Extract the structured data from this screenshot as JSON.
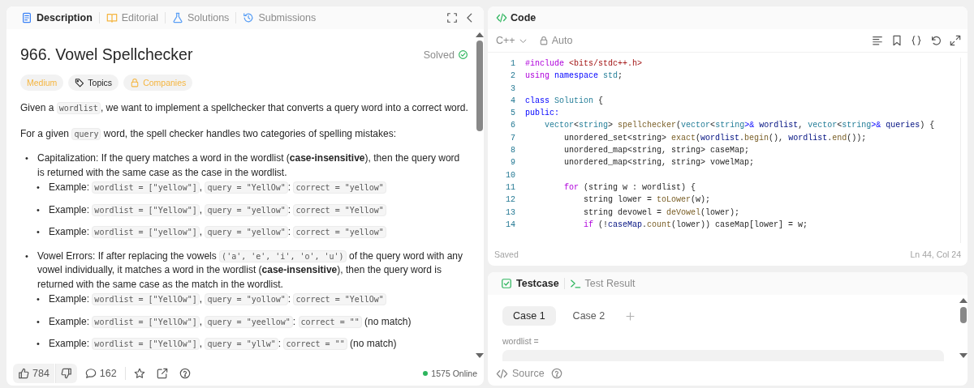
{
  "description": {
    "tabs": [
      {
        "label": "Description",
        "selected": true
      },
      {
        "label": "Editorial",
        "selected": false
      },
      {
        "label": "Solutions",
        "selected": false
      },
      {
        "label": "Submissions",
        "selected": false
      }
    ],
    "title": "966. Vowel Spellchecker",
    "status": "Solved",
    "tags": [
      {
        "label": "Medium",
        "kind": "difficulty"
      },
      {
        "label": "Topics",
        "kind": "topics"
      },
      {
        "label": "Companies",
        "kind": "companies"
      }
    ],
    "content": [
      {
        "kind": "paragraph",
        "parts": [
          {
            "kind": "text",
            "text": "Given a "
          },
          {
            "kind": "code",
            "text": "wordlist"
          },
          {
            "kind": "text",
            "text": ", we want to implement a spellchecker that converts a query word into a correct word."
          }
        ]
      },
      {
        "kind": "paragraph",
        "parts": [
          {
            "kind": "text",
            "text": "For a given "
          },
          {
            "kind": "code",
            "text": "query"
          },
          {
            "kind": "text",
            "text": " word, the spell checker handles two categories of spelling mistakes:"
          }
        ]
      },
      {
        "kind": "bullet",
        "marker": "•",
        "parts": [
          {
            "kind": "text",
            "text": "Capitalization: If the query matches a word in the wordlist ("
          },
          {
            "kind": "bold",
            "text": "case-insensitive"
          },
          {
            "kind": "text",
            "text": "), then the query word is returned with the same case as the case in the wordlist."
          }
        ],
        "children": [
          {
            "marker": "•",
            "parts": [
              {
                "kind": "text",
                "text": "Example: "
              },
              {
                "kind": "code",
                "text": "wordlist = [\"yellow\"]"
              },
              {
                "kind": "text",
                "text": ", "
              },
              {
                "kind": "code",
                "text": "query = \"YellOw\""
              },
              {
                "kind": "text",
                "text": ": "
              },
              {
                "kind": "code",
                "text": "correct = \"yellow\""
              }
            ]
          },
          {
            "marker": "•",
            "parts": [
              {
                "kind": "text",
                "text": "Example: "
              },
              {
                "kind": "code",
                "text": "wordlist = [\"Yellow\"]"
              },
              {
                "kind": "text",
                "text": ", "
              },
              {
                "kind": "code",
                "text": "query = \"yellow\""
              },
              {
                "kind": "text",
                "text": ": "
              },
              {
                "kind": "code",
                "text": "correct = \"Yellow\""
              }
            ]
          },
          {
            "marker": "•",
            "parts": [
              {
                "kind": "text",
                "text": "Example: "
              },
              {
                "kind": "code",
                "text": "wordlist = [\"yellow\"]"
              },
              {
                "kind": "text",
                "text": ", "
              },
              {
                "kind": "code",
                "text": "query = \"yellow\""
              },
              {
                "kind": "text",
                "text": ": "
              },
              {
                "kind": "code",
                "text": "correct = \"yellow\""
              }
            ]
          }
        ]
      },
      {
        "kind": "bullet",
        "marker": "•",
        "parts": [
          {
            "kind": "text",
            "text": "Vowel Errors: If after replacing the vowels "
          },
          {
            "kind": "code",
            "text": "('a', 'e', 'i', 'o', 'u')"
          },
          {
            "kind": "text",
            "text": " of the query word with any vowel individually, it matches a word in the wordlist ("
          },
          {
            "kind": "bold",
            "text": "case-insensitive"
          },
          {
            "kind": "text",
            "text": "), then the query word is returned with the same case as the match in the wordlist."
          }
        ],
        "children": [
          {
            "marker": "•",
            "parts": [
              {
                "kind": "text",
                "text": "Example: "
              },
              {
                "kind": "code",
                "text": "wordlist = [\"YellOw\"]"
              },
              {
                "kind": "text",
                "text": ", "
              },
              {
                "kind": "code",
                "text": "query = \"yollow\""
              },
              {
                "kind": "text",
                "text": ": "
              },
              {
                "kind": "code",
                "text": "correct = \"YellOw\""
              }
            ]
          },
          {
            "marker": "•",
            "parts": [
              {
                "kind": "text",
                "text": "Example: "
              },
              {
                "kind": "code",
                "text": "wordlist = [\"YellOw\"]"
              },
              {
                "kind": "text",
                "text": ", "
              },
              {
                "kind": "code",
                "text": "query = \"yeellow\""
              },
              {
                "kind": "text",
                "text": ": "
              },
              {
                "kind": "code",
                "text": "correct = \"\""
              },
              {
                "kind": "text",
                "text": " (no match)"
              }
            ]
          },
          {
            "marker": "•",
            "parts": [
              {
                "kind": "text",
                "text": "Example: "
              },
              {
                "kind": "code",
                "text": "wordlist = [\"YellOw\"]"
              },
              {
                "kind": "text",
                "text": ", "
              },
              {
                "kind": "code",
                "text": "query = \"yllw\""
              },
              {
                "kind": "text",
                "text": ": "
              },
              {
                "kind": "code",
                "text": "correct = \"\""
              },
              {
                "kind": "text",
                "text": " (no match)"
              }
            ]
          }
        ]
      }
    ],
    "likes": "784",
    "comments": "162",
    "online": "1575 Online"
  },
  "code": {
    "title": "Code",
    "language": "C++",
    "mode": "Auto",
    "lines": [
      {
        "number": "1",
        "tokens": [
          {
            "kind": "keyword",
            "text": "#include"
          },
          {
            "kind": "string",
            "text": " <bits/stdc++.h>"
          }
        ]
      },
      {
        "number": "2",
        "tokens": [
          {
            "kind": "keyword",
            "text": "using"
          },
          {
            "kind": "storage",
            "text": " namespace"
          },
          {
            "kind": "type",
            "text": " std"
          },
          {
            "kind": "plain",
            "text": ";"
          }
        ]
      },
      {
        "number": "3"
      },
      {
        "number": "4",
        "tokens": [
          {
            "kind": "storage",
            "text": "class"
          },
          {
            "kind": "type",
            "text": " Solution"
          },
          {
            "kind": "plain",
            "text": " {"
          }
        ]
      },
      {
        "number": "5",
        "tokens": [
          {
            "kind": "storage",
            "text": "public:"
          }
        ]
      },
      {
        "number": "6",
        "tokens": [
          {
            "kind": "type",
            "text": "    vector"
          },
          {
            "kind": "plain",
            "text": "<"
          },
          {
            "kind": "type",
            "text": "string"
          },
          {
            "kind": "plain",
            "text": "> "
          },
          {
            "kind": "func",
            "text": "spellchecker"
          },
          {
            "kind": "plain",
            "text": "("
          },
          {
            "kind": "type",
            "text": "vector"
          },
          {
            "kind": "plain",
            "text": "<"
          },
          {
            "kind": "type",
            "text": "string"
          },
          {
            "kind": "storage",
            "text": ">&"
          },
          {
            "kind": "var",
            "text": " wordlist"
          },
          {
            "kind": "plain",
            "text": ", "
          },
          {
            "kind": "type",
            "text": "vector"
          },
          {
            "kind": "plain",
            "text": "<"
          },
          {
            "kind": "type",
            "text": "string"
          },
          {
            "kind": "storage",
            "text": ">&"
          },
          {
            "kind": "var",
            "text": " queries"
          },
          {
            "kind": "plain",
            "text": ") {"
          }
        ]
      },
      {
        "number": "7",
        "tokens": [
          {
            "kind": "plain",
            "text": "        unordered_set<string> "
          },
          {
            "kind": "func",
            "text": "exact"
          },
          {
            "kind": "plain",
            "text": "("
          },
          {
            "kind": "var",
            "text": "wordlist"
          },
          {
            "kind": "plain",
            "text": "."
          },
          {
            "kind": "func",
            "text": "begin"
          },
          {
            "kind": "plain",
            "text": "(), "
          },
          {
            "kind": "var",
            "text": "wordlist"
          },
          {
            "kind": "plain",
            "text": "."
          },
          {
            "kind": "func",
            "text": "end"
          },
          {
            "kind": "plain",
            "text": "());"
          }
        ]
      },
      {
        "number": "8",
        "tokens": [
          {
            "kind": "plain",
            "text": "        unordered_map<string, string> caseMap;"
          }
        ]
      },
      {
        "number": "9",
        "tokens": [
          {
            "kind": "plain",
            "text": "        unordered_map<string, string> vowelMap;"
          }
        ]
      },
      {
        "number": "10"
      },
      {
        "number": "11",
        "tokens": [
          {
            "kind": "keyword",
            "text": "        for"
          },
          {
            "kind": "plain",
            "text": " (string w : wordlist) {"
          }
        ]
      },
      {
        "number": "12",
        "tokens": [
          {
            "kind": "plain",
            "text": "            string lower = "
          },
          {
            "kind": "func",
            "text": "toLower"
          },
          {
            "kind": "plain",
            "text": "(w);"
          }
        ]
      },
      {
        "number": "13",
        "tokens": [
          {
            "kind": "plain",
            "text": "            string devowel = "
          },
          {
            "kind": "func",
            "text": "deVowel"
          },
          {
            "kind": "plain",
            "text": "(lower);"
          }
        ]
      },
      {
        "number": "14",
        "tokens": [
          {
            "kind": "keyword",
            "text": "            if"
          },
          {
            "kind": "plain",
            "text": " (!"
          },
          {
            "kind": "var",
            "text": "caseMap"
          },
          {
            "kind": "plain",
            "text": "."
          },
          {
            "kind": "func",
            "text": "count"
          },
          {
            "kind": "plain",
            "text": "(lower)) caseMap[lower] = w;"
          }
        ]
      }
    ],
    "status": "Saved",
    "position": "Ln 44, Col 24"
  },
  "tests": {
    "tabs": [
      {
        "label": "Testcase",
        "selected": true
      },
      {
        "label": "Test Result",
        "selected": false
      }
    ],
    "cases": [
      {
        "label": "Case 1",
        "selected": true
      },
      {
        "label": "Case 2",
        "selected": false
      }
    ],
    "field_label": "wordlist =",
    "source": "Source"
  }
}
